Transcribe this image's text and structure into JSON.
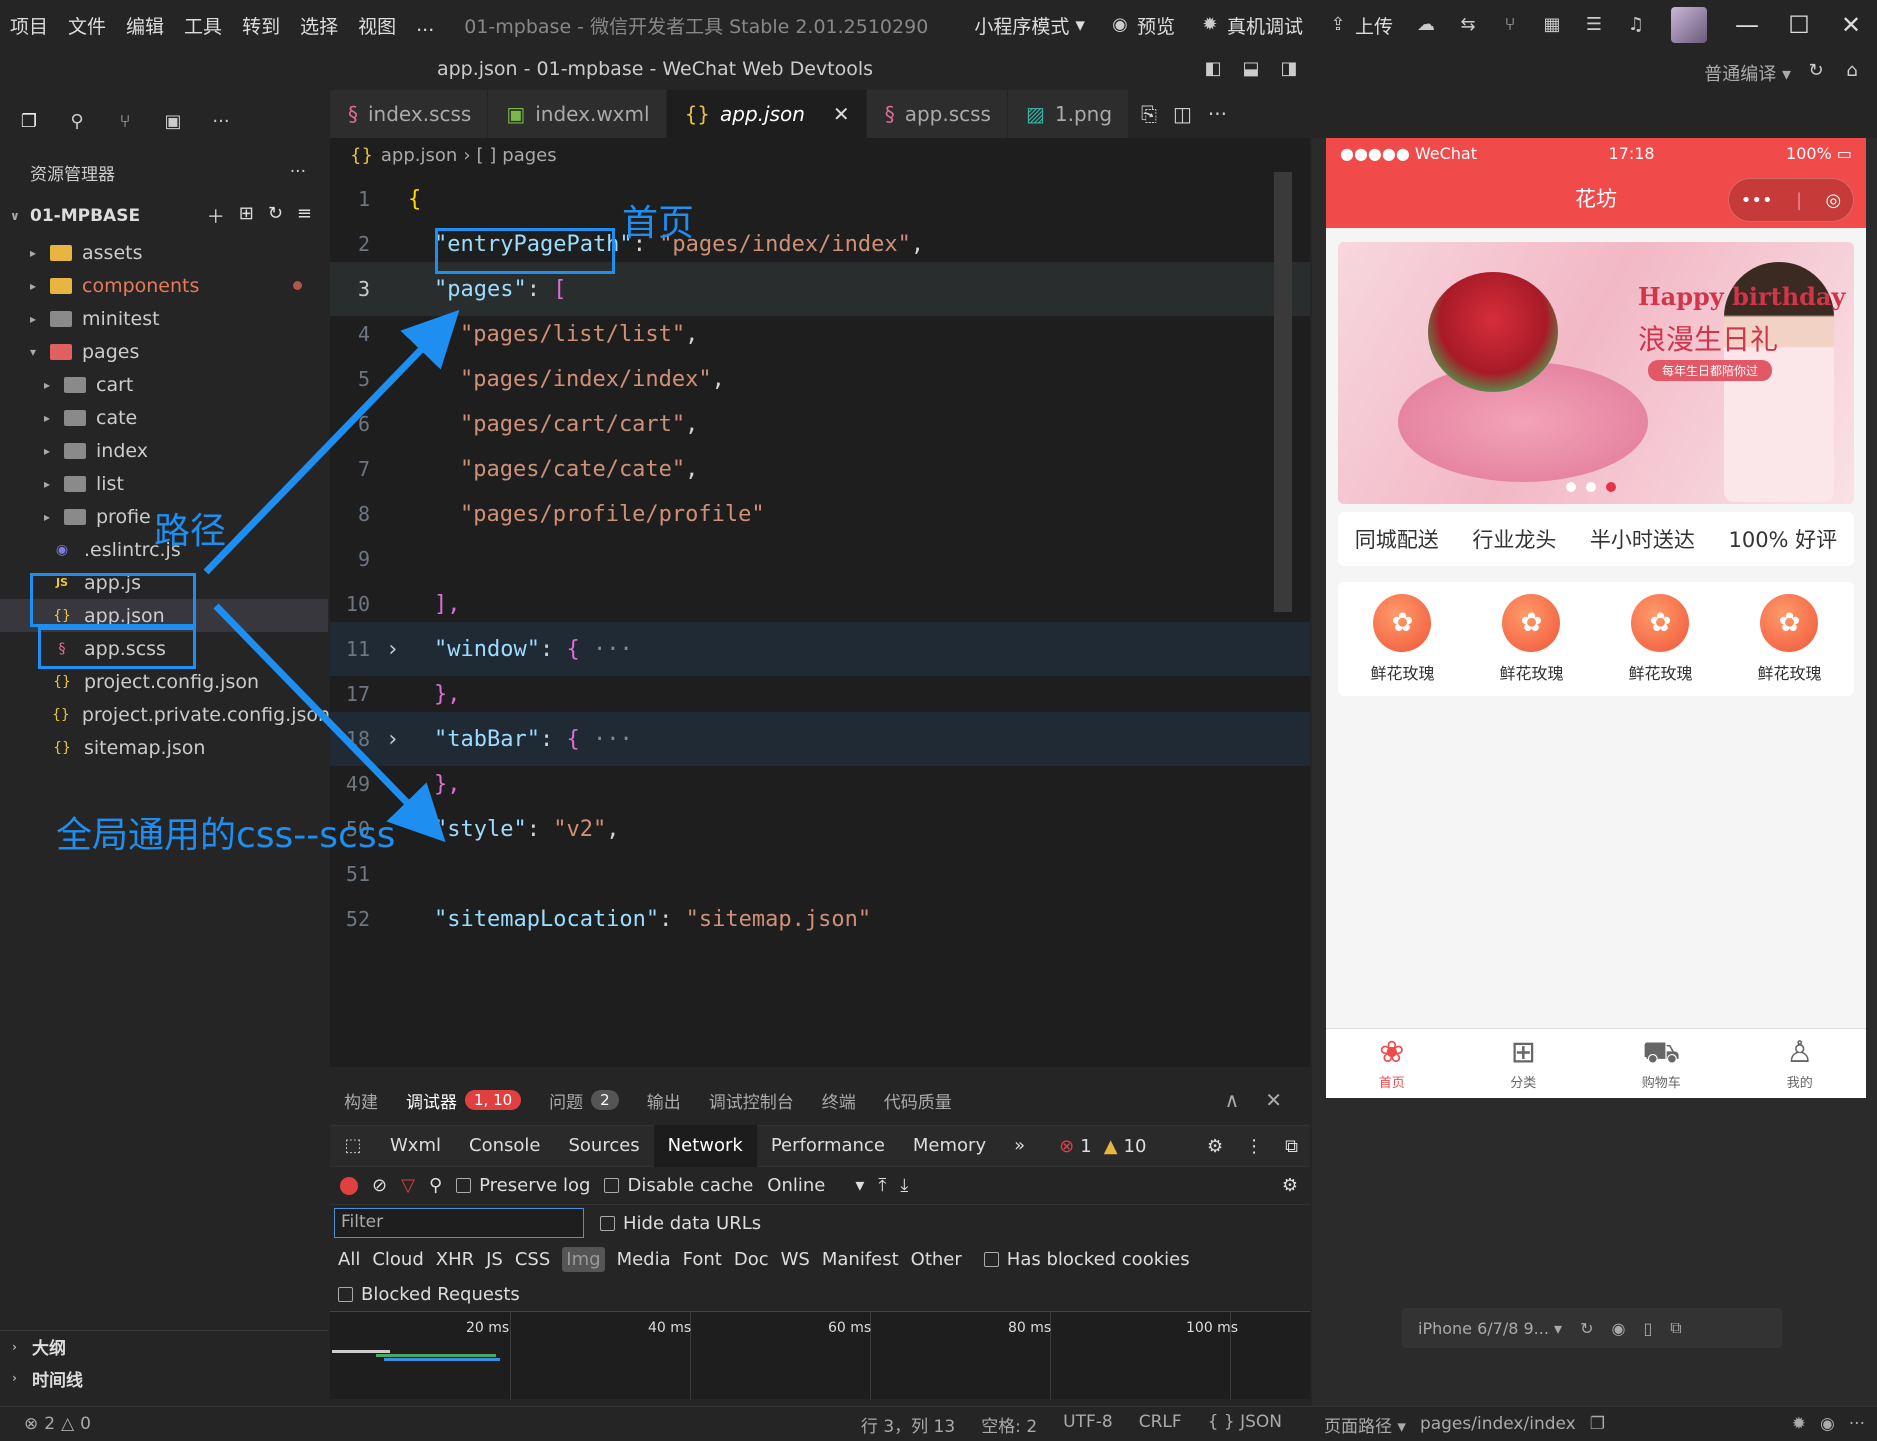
{
  "menu": {
    "items": [
      "项目",
      "文件",
      "编辑",
      "工具",
      "转到",
      "选择",
      "视图",
      "..."
    ],
    "app_title": "01-mpbase - 微信开发者工具 Stable 2.01.2510290",
    "mode": "小程序模式",
    "preview": "预览",
    "real_debug": "真机调试",
    "upload": "上传"
  },
  "window_title": "app.json - 01-mpbase - WeChat Web Devtools",
  "compile_mode": "普通编译",
  "explorer": {
    "header": "资源管理器",
    "project": "01-MPBASE",
    "items": {
      "assets": "assets",
      "components": "components",
      "minitest": "minitest",
      "pages": "pages",
      "cart": "cart",
      "cate": "cate",
      "index": "index",
      "list": "list",
      "profie": "profie",
      "eslintrc": ".eslintrc.js",
      "appjs": "app.js",
      "appjson": "app.json",
      "appscss": "app.scss",
      "projconf": "project.config.json",
      "projpriv": "project.private.config.json",
      "sitemap": "sitemap.json"
    },
    "outline": "大纲",
    "timeline": "时间线"
  },
  "tabs": {
    "t1": "index.scss",
    "t2": "index.wxml",
    "t3": "app.json",
    "t4": "app.scss",
    "t5": "1.png"
  },
  "breadcrumb": {
    "file": "app.json",
    "node": "pages"
  },
  "code": {
    "l1": "{",
    "l2_key": "\"entryPagePath\"",
    "l2_val": "\"pages/index/index\"",
    "l3_key": "\"pages\"",
    "p1": "\"pages/list/list\"",
    "p2": "\"pages/index/index\"",
    "p3": "\"pages/cart/cart\"",
    "p4": "\"pages/cate/cate\"",
    "p5": "\"pages/profile/profile\"",
    "close_arr": "],",
    "window_key": "\"window\"",
    "close_obj": "},",
    "tabbar_key": "\"tabBar\"",
    "close_obj2": "},",
    "style_key": "\"style\"",
    "style_val": "\"v2\"",
    "sitemap_key": "\"sitemapLocation\"",
    "sitemap_val": "\"sitemap.json\"",
    "fold": "···",
    "line_numbers": [
      "1",
      "2",
      "3",
      "4",
      "5",
      "6",
      "7",
      "8",
      "9",
      "10",
      "11",
      "17",
      "18",
      "49",
      "50",
      "51",
      "52"
    ]
  },
  "debugger": {
    "tabs": [
      "构建",
      "调试器",
      "问题",
      "输出",
      "调试控制台",
      "终端",
      "代码质量"
    ],
    "debug_badge": "1, 10",
    "issue_badge": "2",
    "devtools_tabs": [
      "Wxml",
      "Console",
      "Sources",
      "Network",
      "Performance",
      "Memory"
    ],
    "more": "»",
    "errors": "1",
    "warnings": "10",
    "preserve_log": "Preserve log",
    "disable_cache": "Disable cache",
    "throttle": "Online",
    "filter_placeholder": "Filter",
    "hide_data_urls": "Hide data URLs",
    "types": [
      "All",
      "Cloud",
      "XHR",
      "JS",
      "CSS",
      "Img",
      "Media",
      "Font",
      "Doc",
      "WS",
      "Manifest",
      "Other"
    ],
    "has_blocked": "Has blocked cookies",
    "blocked_requests": "Blocked Requests",
    "ticks": [
      "20 ms",
      "40 ms",
      "60 ms",
      "80 ms",
      "100 ms"
    ]
  },
  "status": {
    "errors": "2",
    "warnings": "0",
    "position": "行 3，列 13",
    "spaces": "空格: 2",
    "encoding": "UTF-8",
    "eol": "CRLF",
    "lang": "JSON",
    "page_path_label": "页面路径",
    "page_path": "pages/index/index"
  },
  "phone": {
    "carrier": "●●●●● WeChat",
    "time": "17:18",
    "battery": "100%",
    "nav_title": "花坊",
    "capsule_more": "•••",
    "banner_title": "Happy birthday",
    "banner_cn": "浪漫生日礼",
    "banner_tag": "每年生日都陪你过",
    "features": [
      "同城配送",
      "行业龙头",
      "半小时送达",
      "100% 好评"
    ],
    "categories": [
      "鲜花玫瑰",
      "鲜花玫瑰",
      "鲜花玫瑰",
      "鲜花玫瑰"
    ],
    "tabbar": [
      "首页",
      "分类",
      "购物车",
      "我的"
    ],
    "device": "iPhone 6/7/8 9..."
  },
  "annotations": {
    "home": "首页",
    "path": "路径",
    "global_css": "全局通用的css--scss"
  },
  "colors": {
    "accent_red": "#f04a4a",
    "annotation_blue": "#1e8ef0",
    "editor_bg": "#1e1e1e"
  }
}
